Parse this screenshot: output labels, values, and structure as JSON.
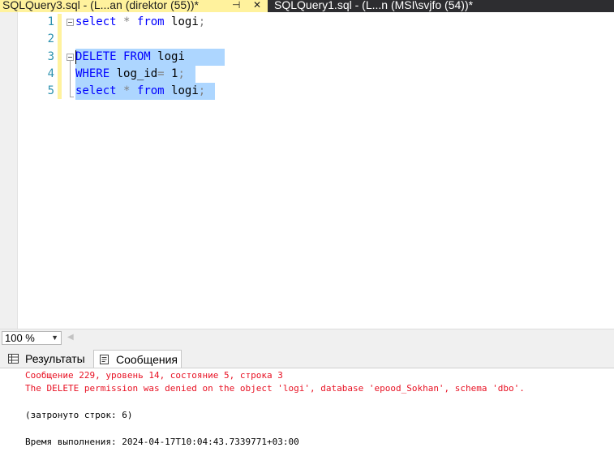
{
  "tabs": [
    {
      "label": "SQLQuery3.sql - (L...an (direktor (55))*",
      "active": true
    },
    {
      "label": "SQLQuery1.sql - (L...n (MSI\\svjfo (54))*",
      "active": false
    }
  ],
  "editor": {
    "line_numbers": [
      "1",
      "2",
      "3",
      "4",
      "5"
    ],
    "line1": {
      "kw1": "select",
      "op1": "*",
      "kw2": "from",
      "t1": "logi",
      "op2": ";"
    },
    "line3": {
      "kw1": "DELETE",
      "kw2": "FROM",
      "t1": "logi"
    },
    "line4": {
      "kw1": "WHERE",
      "t1": "log_id",
      "op1": "=",
      "num": "1",
      "op2": ";"
    },
    "line5": {
      "kw1": "select",
      "op1": "*",
      "kw2": "from",
      "t1": "logi",
      "op2": ";"
    }
  },
  "zoom": {
    "value": "100 %"
  },
  "results_tabs": {
    "results": "Результаты",
    "messages": "Сообщения",
    "active": "messages"
  },
  "messages": {
    "line1": "Сообщение 229, уровень 14, состояние 5, строка 3",
    "line2": "The DELETE permission was denied on the object 'logi', database 'epood_Sokhan', schema 'dbo'.",
    "line3": "(затронуто строк: 6)",
    "line4": "Время выполнения: 2024-04-17T10:04:43.7339771+03:00"
  },
  "colors": {
    "keyword": "#0000ff",
    "operator": "#808080",
    "error": "#e81123",
    "selection": "#add6ff",
    "active_tab": "#fff29d"
  }
}
